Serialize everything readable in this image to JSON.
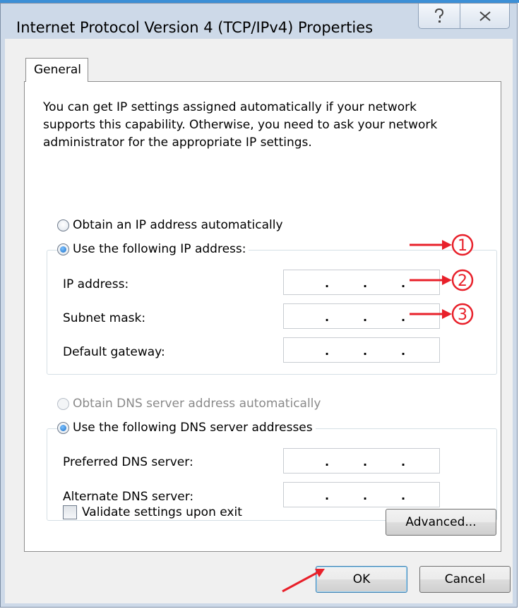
{
  "window": {
    "title": "Internet Protocol Version 4 (TCP/IPv4) Properties",
    "help_icon": "help-icon",
    "close_icon": "close-icon"
  },
  "tabs": [
    {
      "label": "General",
      "selected": true
    }
  ],
  "description": "You can get IP settings assigned automatically if your network supports this capability. Otherwise, you need to ask your network administrator for the appropriate IP settings.",
  "ip_section": {
    "auto_label": "Obtain an IP address automatically",
    "manual_label": "Use the following IP address:",
    "selected": "manual",
    "fields": [
      {
        "label": "IP address:",
        "value": "",
        "marker": "1"
      },
      {
        "label": "Subnet mask:",
        "value": "",
        "marker": "2"
      },
      {
        "label": "Default gateway:",
        "value": "",
        "marker": "3"
      }
    ]
  },
  "dns_section": {
    "auto_label": "Obtain DNS server address automatically",
    "manual_label": "Use the following DNS server addresses",
    "selected": "manual",
    "fields": [
      {
        "label": "Preferred DNS server:",
        "value": ""
      },
      {
        "label": "Alternate DNS server:",
        "value": ""
      }
    ]
  },
  "validate": {
    "label": "Validate settings upon exit",
    "checked": false
  },
  "buttons": {
    "advanced": "Advanced...",
    "ok": "OK",
    "cancel": "Cancel"
  },
  "annotation_color": "#e8202a",
  "accent_color": "#1b6fc6"
}
